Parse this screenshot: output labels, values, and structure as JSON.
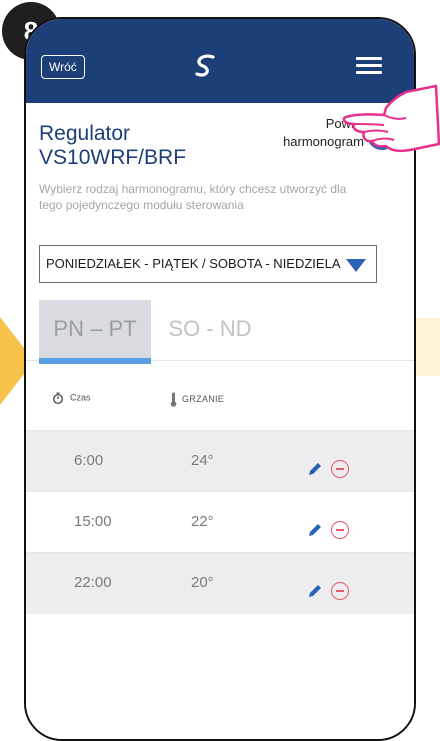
{
  "step_badge": "8",
  "topbar": {
    "back_label": "Wróć",
    "logo_icon": "s-swirl-logo-icon",
    "menu_icon": "hamburger-menu-icon"
  },
  "title": "Regulator VS10WRF/BRF",
  "duplicate": {
    "label": "Powiel harmonogram",
    "plus": "+"
  },
  "description": "Wybierz rodzaj harmonogramu, który chcesz utworzyć dla tego pojedynczego modułu sterowania",
  "schedule_type": {
    "selected": "PONIEDZIAŁEK - PIĄTEK / SOBOTA - NIEDZIELA"
  },
  "tabs": [
    {
      "label": "PN – PT",
      "active": true
    },
    {
      "label": "SO - ND",
      "active": false
    }
  ],
  "columns": {
    "time": "Czas",
    "heating": "GRZANIE"
  },
  "rows": [
    {
      "time": "6:00",
      "temp": "24°"
    },
    {
      "time": "15:00",
      "temp": "22°"
    },
    {
      "time": "22:00",
      "temp": "20°"
    }
  ],
  "colors": {
    "topbar": "#1d3f78",
    "accent_blue": "#2f66ad",
    "title_blue": "#1d3f78",
    "tab_underline": "#5a9fe3",
    "remove_red": "#e55a6a",
    "hand_pink": "#e8308a",
    "highlight_yellow": "#f6c24a"
  }
}
